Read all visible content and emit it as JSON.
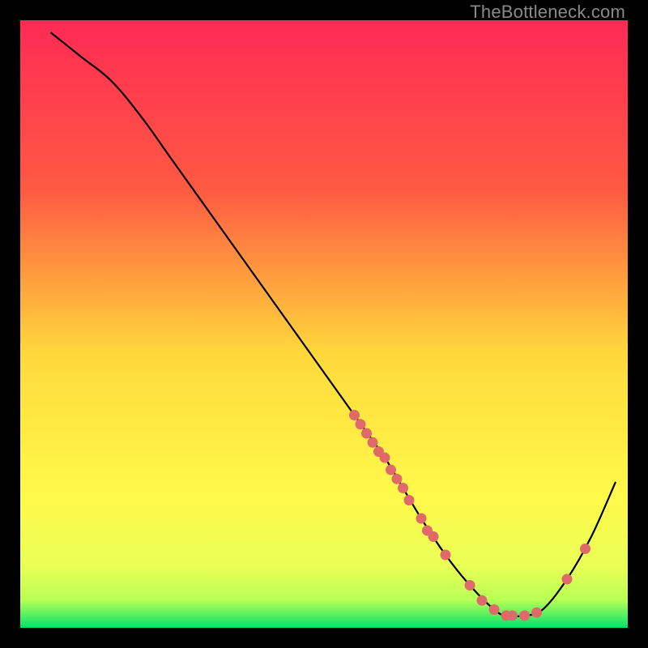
{
  "watermark": "TheBottleneck.com",
  "chart_data": {
    "type": "line",
    "title": "",
    "xlabel": "",
    "ylabel": "",
    "xlim": [
      0,
      100
    ],
    "ylim": [
      0,
      100
    ],
    "gradient_colors": {
      "top": "#ff2a55",
      "mid_upper": "#ff7a3c",
      "mid": "#ffd93b",
      "mid_lower": "#f4ff4a",
      "bottom": "#00e36b"
    },
    "series": [
      {
        "name": "curve",
        "color": "#000000",
        "x": [
          5,
          10,
          15,
          20,
          25,
          30,
          35,
          40,
          45,
          50,
          55,
          60,
          63,
          66,
          70,
          74,
          78,
          80,
          83,
          86,
          90,
          94,
          98
        ],
        "y": [
          98,
          94,
          90,
          84,
          77,
          70,
          63,
          56,
          49,
          42,
          35,
          28,
          23,
          18,
          12,
          7,
          3,
          2,
          2,
          3,
          8,
          15,
          24
        ]
      }
    ],
    "markers": {
      "color": "#e06a6a",
      "points": [
        {
          "x": 55,
          "y": 35
        },
        {
          "x": 56,
          "y": 33.5
        },
        {
          "x": 57,
          "y": 32
        },
        {
          "x": 58,
          "y": 30.5
        },
        {
          "x": 59,
          "y": 29
        },
        {
          "x": 60,
          "y": 28
        },
        {
          "x": 61,
          "y": 26
        },
        {
          "x": 62,
          "y": 24.5
        },
        {
          "x": 63,
          "y": 23
        },
        {
          "x": 64,
          "y": 21
        },
        {
          "x": 66,
          "y": 18
        },
        {
          "x": 67,
          "y": 16
        },
        {
          "x": 68,
          "y": 15
        },
        {
          "x": 70,
          "y": 12
        },
        {
          "x": 74,
          "y": 7
        },
        {
          "x": 76,
          "y": 4.5
        },
        {
          "x": 78,
          "y": 3
        },
        {
          "x": 80,
          "y": 2
        },
        {
          "x": 81,
          "y": 2
        },
        {
          "x": 83,
          "y": 2
        },
        {
          "x": 85,
          "y": 2.5
        },
        {
          "x": 90,
          "y": 8
        },
        {
          "x": 93,
          "y": 13
        }
      ]
    }
  }
}
